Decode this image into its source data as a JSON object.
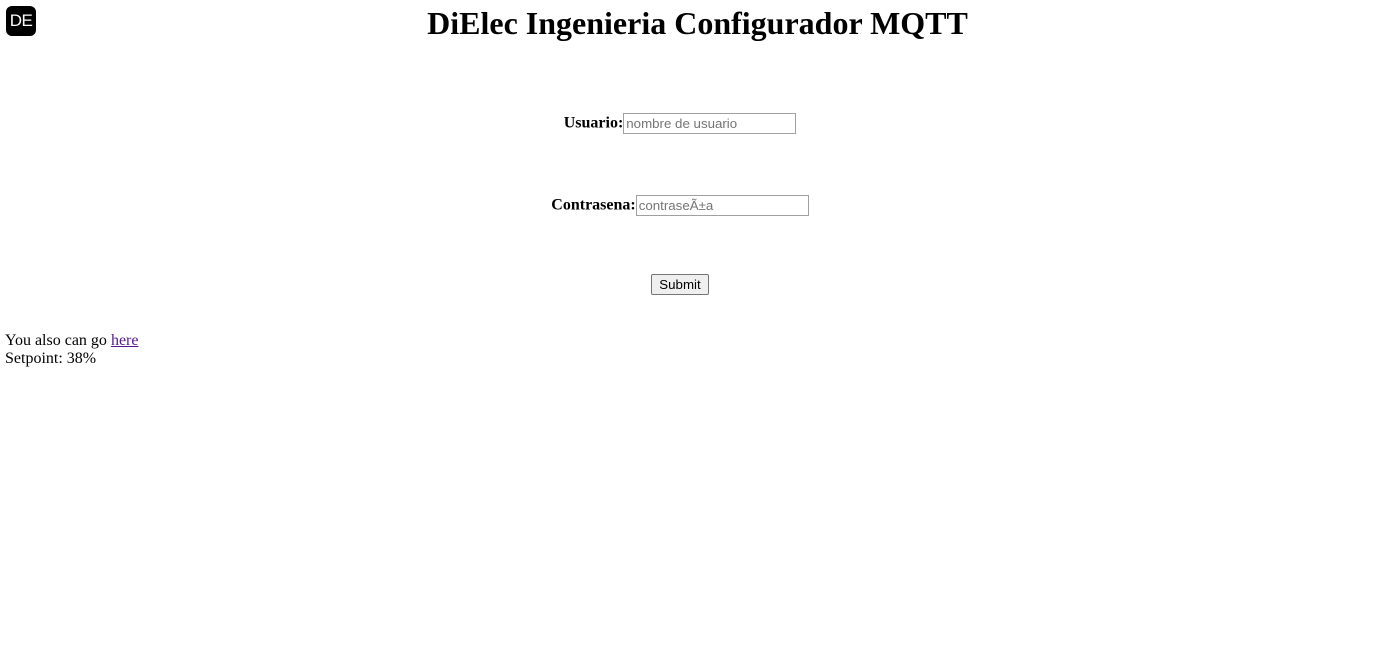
{
  "logo": {
    "text": "DE"
  },
  "header": {
    "title": "DiElec Ingenieria Configurador MQTT"
  },
  "form": {
    "user_label": "Usuario:",
    "user_placeholder": "nombre de usuario",
    "user_value": "",
    "pass_label": "Contrasena:",
    "pass_placeholder": "contraseÃ±a",
    "pass_value": "",
    "submit_label": "Submit"
  },
  "footer": {
    "prefix": "You also can go ",
    "link_label": "here",
    "setpoint_text": "Setpoint: 38%"
  },
  "colors": {
    "link_visited": "#551a8b",
    "logo_bg": "#000000"
  }
}
